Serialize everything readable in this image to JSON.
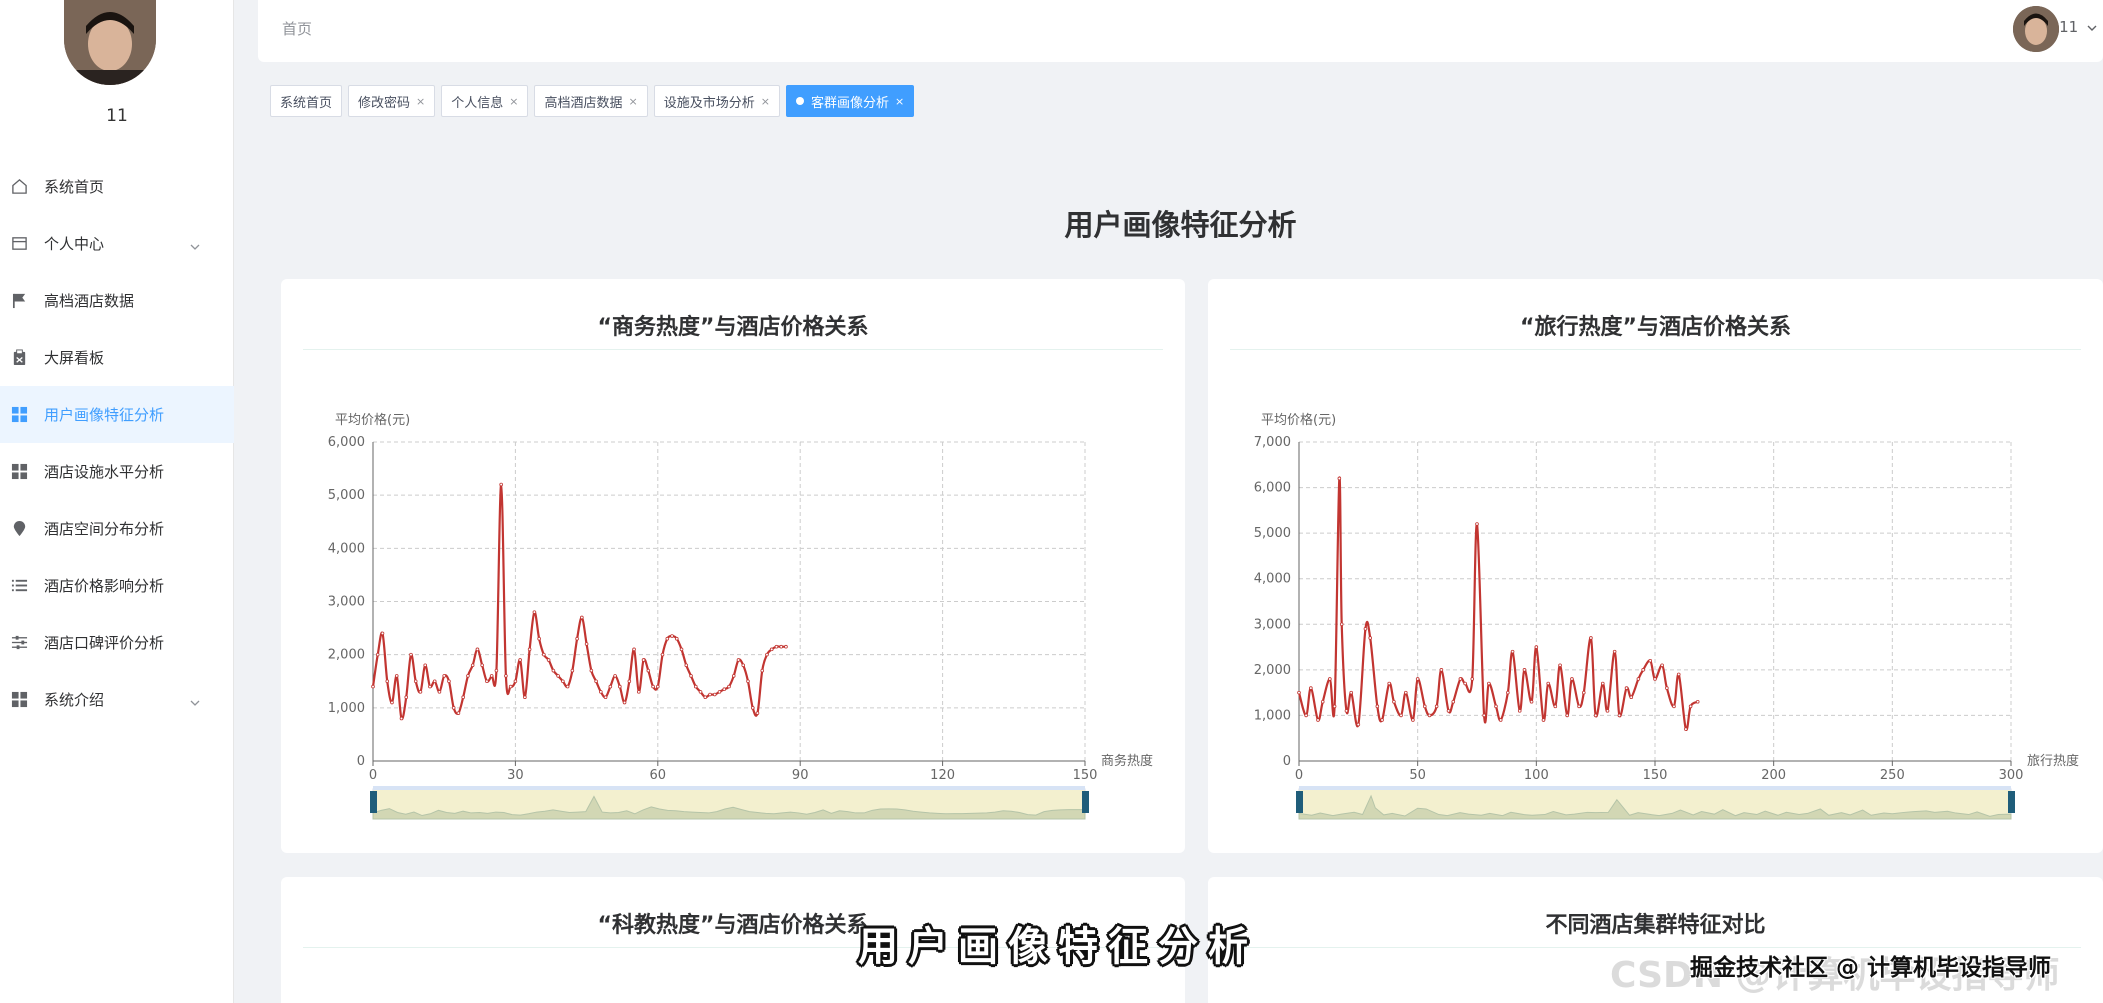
{
  "sidebar": {
    "username": "11",
    "items": [
      {
        "label": "系统首页",
        "icon": "home-icon",
        "active": false,
        "has_arrow": false
      },
      {
        "label": "个人中心",
        "icon": "document-icon",
        "active": false,
        "has_arrow": true
      },
      {
        "label": "高档酒店数据",
        "icon": "flag-icon",
        "active": false,
        "has_arrow": false
      },
      {
        "label": "大屏看板",
        "icon": "clipboard-icon",
        "active": false,
        "has_arrow": false
      },
      {
        "label": "用户画像特征分析",
        "icon": "grid-icon",
        "active": true,
        "has_arrow": false
      },
      {
        "label": "酒店设施水平分析",
        "icon": "grid-icon",
        "active": false,
        "has_arrow": false
      },
      {
        "label": "酒店空间分布分析",
        "icon": "location-icon",
        "active": false,
        "has_arrow": false
      },
      {
        "label": "酒店价格影响分析",
        "icon": "list-icon",
        "active": false,
        "has_arrow": false
      },
      {
        "label": "酒店口碑评价分析",
        "icon": "sliders-icon",
        "active": false,
        "has_arrow": false
      },
      {
        "label": "系统介绍",
        "icon": "grid-icon",
        "active": false,
        "has_arrow": true
      }
    ]
  },
  "header": {
    "breadcrumb": "首页",
    "user_name": "11"
  },
  "tags": [
    {
      "label": "系统首页",
      "closable": false,
      "active": false
    },
    {
      "label": "修改密码",
      "closable": true,
      "active": false
    },
    {
      "label": "个人信息",
      "closable": true,
      "active": false
    },
    {
      "label": "高档酒店数据",
      "closable": true,
      "active": false
    },
    {
      "label": "设施及市场分析",
      "closable": true,
      "active": false
    },
    {
      "label": "客群画像分析",
      "closable": true,
      "active": true
    }
  ],
  "page_title": "用户画像特征分析",
  "colors": {
    "accent": "#409eff",
    "line": "#c23531",
    "slider_fill": "#f5f0c8",
    "slider_handle": "#1f5d7a"
  },
  "chart_data": [
    {
      "type": "line",
      "title": "“商务热度”与酒店价格关系",
      "xlabel": "商务热度",
      "ylabel": "平均价格(元)",
      "xlim": [
        0,
        150
      ],
      "ylim": [
        0,
        6000
      ],
      "xticks": [
        0,
        30,
        60,
        90,
        120,
        150
      ],
      "yticks": [
        0,
        1000,
        2000,
        3000,
        4000,
        5000,
        6000
      ],
      "ytick_labels": [
        "0",
        "1,000",
        "2,000",
        "3,000",
        "4,000",
        "5,000",
        "6,000"
      ],
      "grid": true,
      "series": [
        {
          "x": [
            0,
            1,
            2,
            3,
            4,
            5,
            6,
            7,
            8,
            9,
            10,
            11,
            12,
            13,
            14,
            15,
            16,
            17,
            18,
            19,
            20,
            21,
            22,
            23,
            24,
            25,
            26,
            27,
            28,
            29,
            30,
            31,
            32,
            33,
            34,
            35,
            36,
            37,
            38,
            39,
            40,
            41,
            42,
            43,
            44,
            45,
            46,
            47,
            48,
            49,
            50,
            51,
            52,
            53,
            54,
            55,
            56,
            57,
            58,
            59,
            60,
            61,
            62,
            63,
            64,
            65,
            66,
            67,
            68,
            69,
            70,
            71,
            72,
            73,
            74,
            75,
            76,
            77,
            78,
            79,
            80,
            81,
            82,
            83,
            84,
            85,
            86,
            87
          ],
          "y": [
            1400,
            2000,
            2400,
            1500,
            1100,
            1600,
            800,
            1200,
            2000,
            1500,
            1300,
            1800,
            1400,
            1500,
            1300,
            1600,
            1500,
            1000,
            900,
            1200,
            1600,
            1800,
            2100,
            1800,
            1500,
            1600,
            1700,
            5200,
            1600,
            1400,
            1500,
            1900,
            1200,
            2100,
            2800,
            2300,
            2000,
            1900,
            1700,
            1600,
            1500,
            1400,
            1700,
            2300,
            2700,
            2200,
            1700,
            1500,
            1300,
            1200,
            1400,
            1600,
            1400,
            1100,
            1500,
            2100,
            1300,
            1900,
            1700,
            1400,
            1400,
            2000,
            2300,
            2350,
            2300,
            2100,
            1800,
            1600,
            1400,
            1300,
            1200,
            1250,
            1250,
            1300,
            1350,
            1400,
            1600,
            1900,
            1800,
            1500,
            1000,
            900,
            1700,
            2000,
            2100,
            2150,
            2150,
            2150
          ]
        }
      ]
    },
    {
      "type": "line",
      "title": "“旅行热度”与酒店价格关系",
      "xlabel": "旅行热度",
      "ylabel": "平均价格(元)",
      "xlim": [
        0,
        300
      ],
      "ylim": [
        0,
        7000
      ],
      "xticks": [
        0,
        50,
        100,
        150,
        200,
        250,
        300
      ],
      "yticks": [
        0,
        1000,
        2000,
        3000,
        4000,
        5000,
        6000,
        7000
      ],
      "ytick_labels": [
        "0",
        "1,000",
        "2,000",
        "3,000",
        "4,000",
        "5,000",
        "6,000",
        "7,000"
      ],
      "grid": true,
      "series": [
        {
          "x": [
            0,
            3,
            5,
            8,
            10,
            13,
            15,
            17,
            18,
            20,
            22,
            25,
            28,
            30,
            33,
            35,
            38,
            40,
            43,
            45,
            48,
            50,
            53,
            55,
            58,
            60,
            63,
            65,
            68,
            70,
            73,
            75,
            78,
            80,
            83,
            85,
            88,
            90,
            93,
            95,
            98,
            100,
            103,
            105,
            108,
            110,
            113,
            115,
            118,
            120,
            123,
            125,
            128,
            130,
            133,
            135,
            138,
            140,
            143,
            145,
            148,
            150,
            153,
            155,
            158,
            160,
            163,
            165,
            168
          ],
          "y": [
            1500,
            1000,
            1600,
            900,
            1300,
            1800,
            1200,
            6200,
            3000,
            1100,
            1500,
            800,
            2900,
            2700,
            1200,
            900,
            1700,
            1300,
            1000,
            1500,
            900,
            1800,
            1200,
            1000,
            1200,
            2000,
            1100,
            1300,
            1800,
            1700,
            1800,
            5200,
            1000,
            1700,
            1200,
            900,
            1500,
            2400,
            1100,
            2000,
            1300,
            2500,
            900,
            1700,
            1200,
            2100,
            1000,
            1800,
            1200,
            1500,
            2700,
            1000,
            1700,
            1100,
            2400,
            1000,
            1600,
            1400,
            1800,
            2000,
            2200,
            1800,
            2100,
            1600,
            1200,
            1900,
            700,
            1200,
            1300
          ]
        }
      ]
    },
    {
      "type": "line",
      "title": "“科教热度”与酒店价格关系"
    },
    {
      "type": "line",
      "title": "不同酒店集群特征对比"
    }
  ],
  "overlay": {
    "subtitle": "用户画像特征分析",
    "watermark_left": "CSDN @计算机毕设指导师",
    "watermark_right": "掘金技术社区 @ 计算机毕设指导师"
  }
}
